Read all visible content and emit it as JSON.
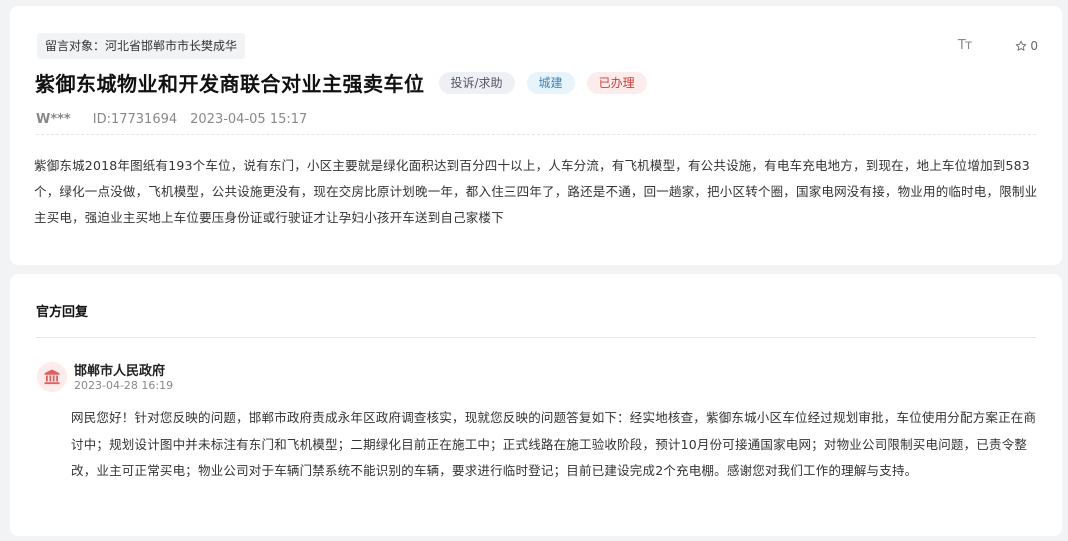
{
  "message": {
    "target_label": "留言对象：河北省邯郸市市长樊成华",
    "font_size_toggle": "Tт",
    "favorite_count": "0",
    "title": "紫御东城物业和开发商联合对业主强卖车位",
    "tags": {
      "type": "投诉/求助",
      "category": "城建",
      "status": "已办理"
    },
    "user": "W***",
    "id": "ID:17731694",
    "time": "2023-04-05 15:17",
    "content": "紫御东城2018年图纸有193个车位，说有东门，小区主要就是绿化面积达到百分四十以上，人车分流，有飞机模型，有公共设施，有电车充电地方，到现在，地上车位增加到583个，绿化一点没做，飞机模型，公共设施更没有，现在交房比原计划晚一年，都入住三四年了，路还是不通，回一趟家，把小区转个圈，国家电网没有接，物业用的临时电，限制业主买电，强迫业主买地上车位要压身份证或行驶证才让孕妇小孩开车送到自己家楼下"
  },
  "reply": {
    "heading": "官方回复",
    "org_name": "邯郸市人民政府",
    "time": "2023-04-28 16:19",
    "content": "网民您好！针对您反映的问题，邯郸市政府责成永年区政府调查核实，现就您反映的问题答复如下：经实地核查，紫御东城小区车位经过规划审批，车位使用分配方案正在商讨中；规划设计图中并未标注有东门和飞机模型；二期绿化目前正在施工中；正式线路在施工验收阶段，预计10月份可接通国家电网；对物业公司限制买电问题，已责令整改，业主可正常买电；物业公司对于车辆门禁系统不能识别的车辆，要求进行临时登记；目前已建设完成2个充电棚。感谢您对我们工作的理解与支持。"
  },
  "colors": {
    "status_red": "#d33a3a",
    "category_blue": "#3a83b8",
    "gov_icon": "#e35d5d"
  }
}
